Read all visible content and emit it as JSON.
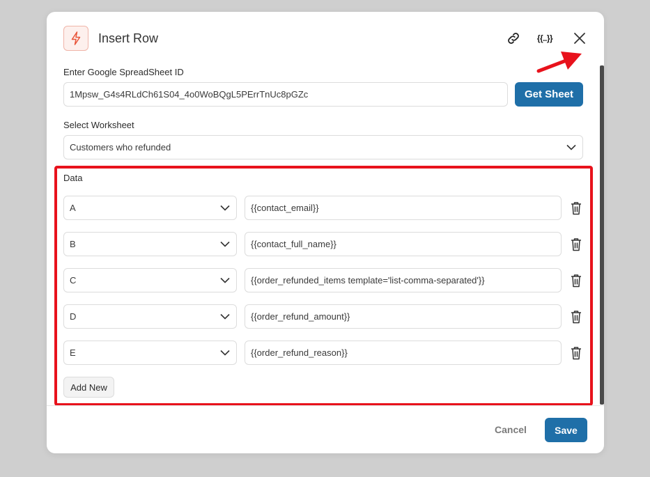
{
  "header": {
    "title": "Insert Row",
    "vars_glyph": "{{..}}"
  },
  "spreadsheet": {
    "label": "Enter Google SpreadSheet ID",
    "value": "1Mpsw_G4s4RLdCh61S04_4o0WoBQgL5PErrTnUc8pGZc",
    "get_sheet_label": "Get Sheet"
  },
  "worksheet": {
    "label": "Select Worksheet",
    "value": "Customers who refunded"
  },
  "data": {
    "label": "Data",
    "rows": [
      {
        "column": "A",
        "value": "{{contact_email}}"
      },
      {
        "column": "B",
        "value": "{{contact_full_name}}"
      },
      {
        "column": "C",
        "value": "{{order_refunded_items template='list-comma-separated'}}"
      },
      {
        "column": "D",
        "value": "{{order_refund_amount}}"
      },
      {
        "column": "E",
        "value": "{{order_refund_reason}}"
      }
    ],
    "add_new_label": "Add New"
  },
  "footer": {
    "cancel_label": "Cancel",
    "save_label": "Save"
  },
  "colors": {
    "primary": "#1f6fa8",
    "annotation": "#e8121c",
    "accent_icon": "#e8553a"
  },
  "icons": {
    "app": "bolt-icon",
    "link": "link-icon",
    "variables": "curly-braces-icon",
    "close": "close-icon",
    "dropdown": "chevron-down-icon",
    "delete": "trash-icon"
  }
}
